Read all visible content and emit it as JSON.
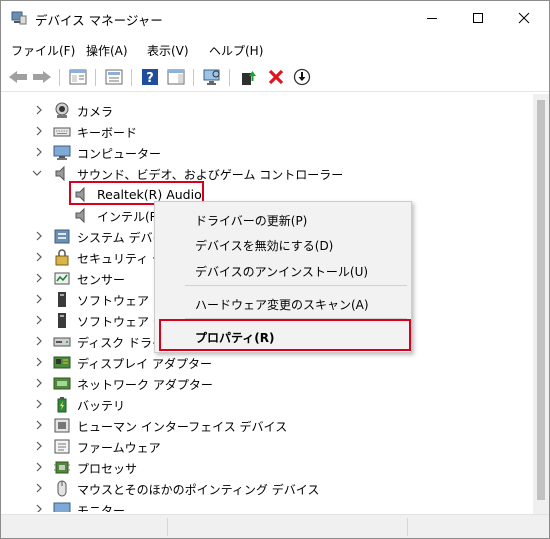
{
  "window": {
    "title": "デバイス マネージャー",
    "minimize_icon": "minimize-icon",
    "maximize_icon": "maximize-icon",
    "close_icon": "close-icon"
  },
  "menu": [
    {
      "label": "ファイル(F)"
    },
    {
      "label": "操作(A)"
    },
    {
      "label": "表示(V)"
    },
    {
      "label": "ヘルプ(H)"
    }
  ],
  "toolbar": [
    "back-arrow-icon",
    "forward-arrow-icon",
    "show-hide-tree-icon",
    "properties-sheet-icon",
    "help-icon",
    "action-pane-icon",
    "monitor-scan-icon",
    "update-driver-icon",
    "uninstall-x-icon",
    "download-circle-icon"
  ],
  "tree": {
    "items": [
      {
        "label": "カメラ",
        "icon": "camera-icon",
        "expanded": false
      },
      {
        "label": "キーボード",
        "icon": "keyboard-icon",
        "expanded": false
      },
      {
        "label": "コンピューター",
        "icon": "computer-icon",
        "expanded": false
      },
      {
        "label": "サウンド、ビデオ、およびゲーム コントローラー",
        "icon": "speaker-icon",
        "expanded": true
      },
      {
        "label": "Realtek(R) Audio",
        "icon": "speaker-icon",
        "child": true,
        "selected": true
      },
      {
        "label": "インテル(R)",
        "icon": "speaker-icon",
        "child": true
      },
      {
        "label": "システム デバイス",
        "icon": "system-device-icon",
        "expanded": false
      },
      {
        "label": "セキュリティ デバ",
        "icon": "security-device-icon",
        "expanded": false
      },
      {
        "label": "センサー",
        "icon": "sensor-icon",
        "expanded": false
      },
      {
        "label": "ソフトウェア コン",
        "icon": "software-component-icon",
        "expanded": false
      },
      {
        "label": "ソフトウェア デバ",
        "icon": "software-device-icon",
        "expanded": false
      },
      {
        "label": "ディスク ドライブ",
        "icon": "disk-drive-icon",
        "expanded": false
      },
      {
        "label": "ディスプレイ アダプター",
        "icon": "display-adapter-icon",
        "expanded": false
      },
      {
        "label": "ネットワーク アダプター",
        "icon": "network-adapter-icon",
        "expanded": false
      },
      {
        "label": "バッテリ",
        "icon": "battery-icon",
        "expanded": false
      },
      {
        "label": "ヒューマン インターフェイス デバイス",
        "icon": "hid-icon",
        "expanded": false
      },
      {
        "label": "ファームウェア",
        "icon": "firmware-icon",
        "expanded": false
      },
      {
        "label": "プロセッサ",
        "icon": "processor-icon",
        "expanded": false
      },
      {
        "label": "マウスとそのほかのポインティング デバイス",
        "icon": "mouse-icon",
        "expanded": false
      },
      {
        "label": "モニター",
        "icon": "monitor-icon",
        "expanded": false
      }
    ]
  },
  "context_menu": {
    "items": [
      {
        "label": "ドライバーの更新(P)"
      },
      {
        "label": "デバイスを無効にする(D)"
      },
      {
        "label": "デバイスのアンインストール(U)"
      },
      {
        "label": "ハードウェア変更のスキャン(A)"
      },
      {
        "label": "プロパティ(R)",
        "bold": true
      }
    ]
  },
  "colors": {
    "highlight_border": "#d9001b",
    "selection": "#cce8ff"
  }
}
